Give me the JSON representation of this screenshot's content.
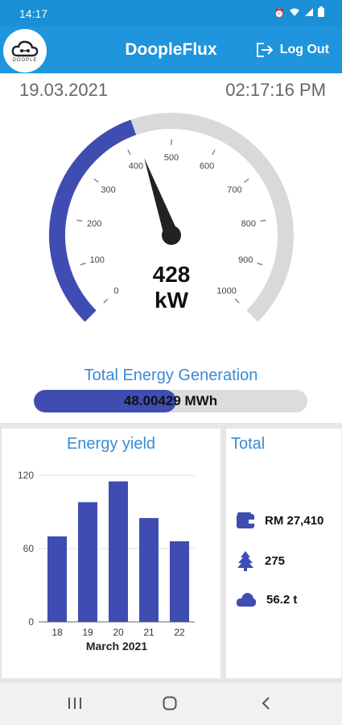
{
  "status": {
    "time": "14:17"
  },
  "app": {
    "title": "DoopleFlux",
    "logo_text": "DOOPLE",
    "logout_label": "Log Out"
  },
  "gauge": {
    "date": "19.03.2021",
    "clock": "02:17:16 PM",
    "value": 428,
    "value_text": "428",
    "unit": "kW",
    "min": 0,
    "max": 1000,
    "ticks": [
      "0",
      "100",
      "200",
      "300",
      "400",
      "500",
      "600",
      "700",
      "800",
      "900",
      "1000"
    ],
    "colors": {
      "fill": "#3f4db3",
      "track": "#d9d9d9",
      "needle": "#222222"
    }
  },
  "generation": {
    "label": "Total Energy Generation",
    "value_text": "48.00429 MWh",
    "fill_fraction": 0.52
  },
  "chart_data": {
    "type": "bar",
    "title": "Energy yield",
    "xlabel": "March 2021",
    "ylabel": "",
    "categories": [
      "18",
      "19",
      "20",
      "21",
      "22"
    ],
    "values": [
      70,
      98,
      115,
      85,
      66
    ],
    "yticks": [
      "0",
      "60",
      "120"
    ],
    "ylim": [
      0,
      120
    ],
    "grid": true,
    "color": "#3f4db3"
  },
  "totals": {
    "title": "Total",
    "items": [
      {
        "icon": "wallet-icon",
        "value": "RM 27,410"
      },
      {
        "icon": "tree-icon",
        "value": "275"
      },
      {
        "icon": "cloud-icon",
        "value": "56.2 t"
      }
    ]
  }
}
